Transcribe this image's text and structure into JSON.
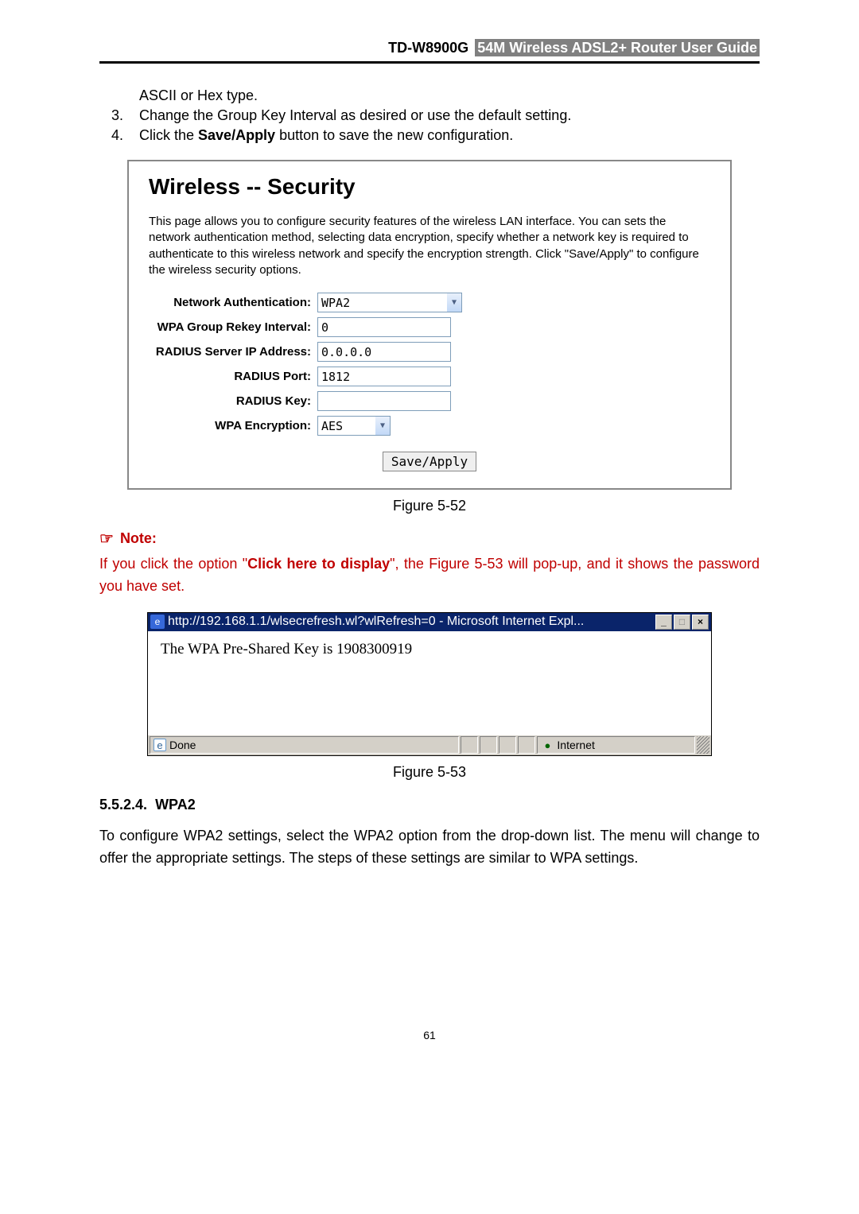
{
  "header": {
    "model": "TD-W8900G",
    "title": "54M Wireless ADSL2+ Router User Guide"
  },
  "intro": "ASCII or Hex type.",
  "step3_num": "3.",
  "step3_text": "Change the Group Key Interval as desired or use the default setting.",
  "step4_num": "4.",
  "step4_text_a": "Click the ",
  "step4_bold": "Save/Apply",
  "step4_text_b": " button to save the new configuration.",
  "panel": {
    "title": "Wireless -- Security",
    "desc": "This page allows you to configure security features of the wireless LAN interface. You can sets the network authentication method, selecting data encryption, specify whether a network key is required to authenticate to this wireless network and specify the encryption strength. Click \"Save/Apply\" to configure the wireless security options.",
    "labels": {
      "auth": "Network Authentication:",
      "rekey": "WPA Group Rekey Interval:",
      "radius_ip": "RADIUS Server IP Address:",
      "radius_port": "RADIUS Port:",
      "radius_key": "RADIUS Key:",
      "wpa_enc": "WPA Encryption:"
    },
    "values": {
      "auth": "WPA2",
      "rekey": "0",
      "radius_ip": "0.0.0.0",
      "radius_port": "1812",
      "radius_key": "",
      "wpa_enc": "AES"
    },
    "button": "Save/Apply"
  },
  "caption1": "Figure 5-52",
  "note_label": "Note:",
  "note_a": "If you click the option \"",
  "note_bold": "Click here to display",
  "note_b": "\", the Figure 5-53 will pop-up, and it shows the password you have set.",
  "ie": {
    "title": "http://192.168.1.1/wlsecrefresh.wl?wlRefresh=0 - Microsoft Internet Expl...",
    "body": "The WPA Pre-Shared Key is 1908300919",
    "done": "Done",
    "internet": "Internet"
  },
  "caption2": "Figure 5-53",
  "section_num": "5.5.2.4.",
  "section_title": "WPA2",
  "para": "To configure WPA2 settings, select the WPA2 option from the drop-down list. The menu will change to offer the appropriate settings. The steps of these settings are similar to WPA settings.",
  "page_number": "61"
}
